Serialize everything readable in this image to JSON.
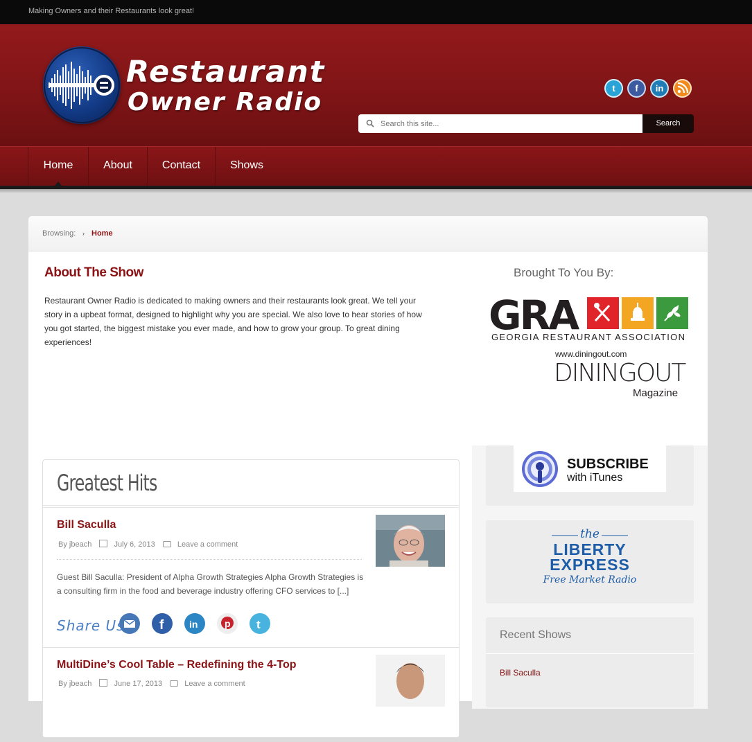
{
  "topbar": {
    "tagline": "Making Owners and their Restaurants look great!"
  },
  "header": {
    "logo_line1": "Restaurant",
    "logo_line2": "Owner Radio",
    "social": [
      {
        "name": "twitter",
        "color": "#2aa3d6"
      },
      {
        "name": "facebook",
        "color": "#3b5aa0"
      },
      {
        "name": "linkedin",
        "color": "#1f7cb4"
      },
      {
        "name": "rss",
        "color": "#f08a1c"
      }
    ],
    "search_placeholder": "Search this site...",
    "search_button": "Search"
  },
  "nav": {
    "items": [
      {
        "label": "Home"
      },
      {
        "label": "About"
      },
      {
        "label": "Contact"
      },
      {
        "label": "Shows"
      }
    ]
  },
  "breadcrumb": {
    "label": "Browsing:",
    "current": "Home"
  },
  "about": {
    "title": "About The Show",
    "text": "Restaurant Owner Radio is dedicated to making owners and their restaurants look great. We tell your story in a upbeat format, designed to highlight why you are special. We also love to hear stories of how you got started, the biggest mistake you ever made, and how to grow your group. To great dining experiences!"
  },
  "sponsors": {
    "heading": "Brought To You By:",
    "gra": {
      "letters": "GRA",
      "subtitle": "GEORGIA RESTAURANT ASSOCIATION"
    },
    "dining": {
      "url": "www.diningout.com",
      "name": "DININGOUT",
      "sub": "Magazine"
    }
  },
  "greatest_hits": {
    "title": "Greatest Hits",
    "posts": [
      {
        "title": "Bill Saculla",
        "author": "By jbeach",
        "date": "July 6, 2013",
        "comments": "Leave a comment",
        "excerpt": "Guest Bill Saculla: President of Alpha Growth Strategies Alpha Growth Strategies is a consulting firm in the food and beverage industry offering CFO services to [...]"
      },
      {
        "title": "MultiDine’s Cool Table – Redefining the 4-Top",
        "author": "By jbeach",
        "date": "June 17, 2013",
        "comments": "Leave a comment"
      }
    ],
    "share_label": "Share Us!"
  },
  "sidebar": {
    "itunes_line1": "SUBSCRIBE",
    "itunes_line2": "with iTunes",
    "liberty": {
      "the": "the",
      "line1": "LIBERTY",
      "line2": "EXPRESS",
      "tag": "Free Market Radio"
    },
    "recent": {
      "title": "Recent Shows",
      "items": [
        "Bill Saculla"
      ]
    }
  }
}
